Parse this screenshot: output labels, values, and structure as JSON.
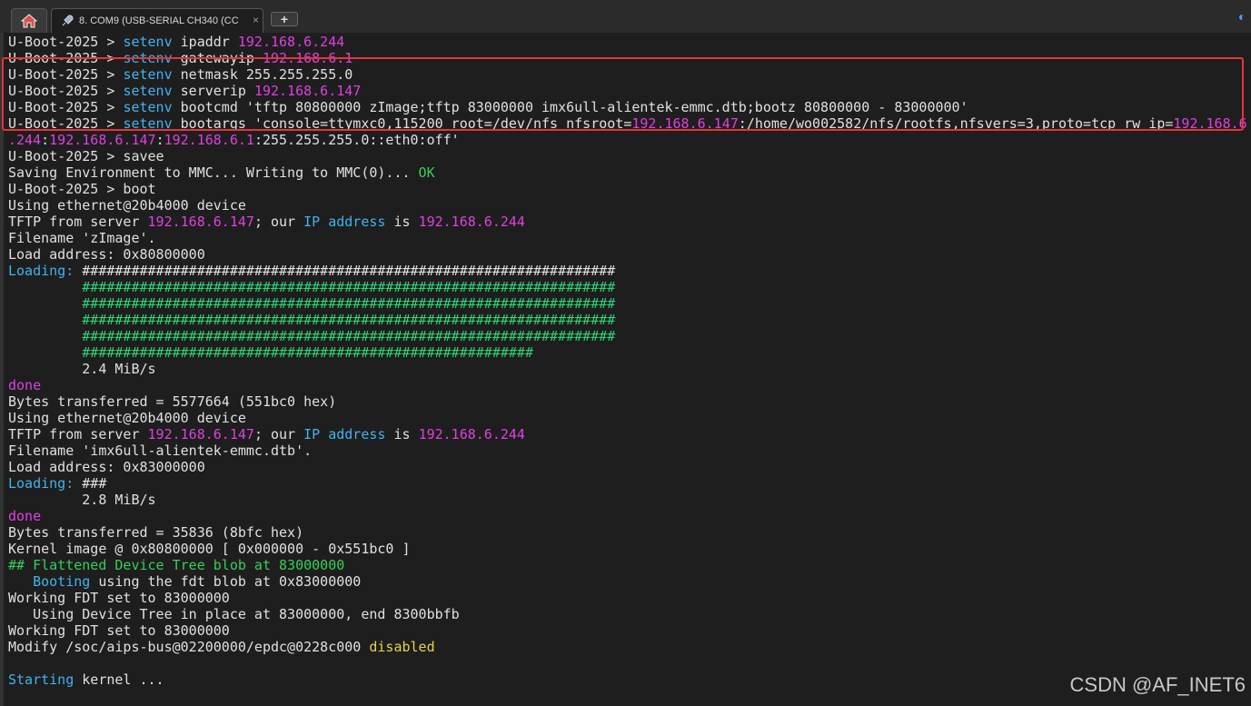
{
  "tabs": {
    "home_icon": "home-icon",
    "active_tab_label": "8. COM9  (USB-SERIAL CH340 (CC",
    "active_tab_icon": "rocket-icon",
    "close_glyph": "×",
    "new_tab_glyph": "+",
    "menu_glyph": "◐"
  },
  "terminal": {
    "lines": [
      [
        [
          "U-Boot-2025 > ",
          "d"
        ],
        [
          "setenv",
          "c"
        ],
        [
          " ipaddr ",
          "d"
        ],
        [
          "192.168.6.244",
          "m"
        ]
      ],
      [
        [
          "U-Boot-2025 > ",
          "d"
        ],
        [
          "setenv",
          "c"
        ],
        [
          " gatewayip ",
          "d"
        ],
        [
          "192.168.6.1",
          "m"
        ]
      ],
      [
        [
          "U-Boot-2025 > ",
          "d"
        ],
        [
          "setenv",
          "c"
        ],
        [
          " netmask 255.255.255.0",
          "d"
        ]
      ],
      [
        [
          "U-Boot-2025 > ",
          "d"
        ],
        [
          "setenv",
          "c"
        ],
        [
          " serverip ",
          "d"
        ],
        [
          "192.168.6.147",
          "m"
        ]
      ],
      [
        [
          "U-Boot-2025 > ",
          "d"
        ],
        [
          "setenv",
          "c"
        ],
        [
          " bootcmd 'tftp 80800000 zImage;tftp 83000000 imx6ull-alientek-emmc.dtb;bootz 80800000 - 83000000'",
          "d"
        ]
      ],
      [
        [
          "U-Boot-2025 > ",
          "d"
        ],
        [
          "setenv",
          "c"
        ],
        [
          " bootargs 'console=ttymxc0,115200 root=/dev/nfs nfsroot=",
          "d"
        ],
        [
          "192.168.6.147",
          "m"
        ],
        [
          ":/home/wo002582/nfs/rootfs,nfsvers=3,proto=tcp rw ip=",
          "d"
        ],
        [
          "192.168.6",
          "m"
        ]
      ],
      [
        [
          ".244",
          "m"
        ],
        [
          ":",
          "d"
        ],
        [
          "192.168.6.147",
          "m"
        ],
        [
          ":",
          "d"
        ],
        [
          "192.168.6.1",
          "m"
        ],
        [
          ":255.255.255.0::eth0:off'",
          "d"
        ]
      ],
      [
        [
          "U-Boot-2025 > savee",
          "d"
        ]
      ],
      [
        [
          "Saving Environment to MMC... Writing to MMC(0)... ",
          "d"
        ],
        [
          "OK",
          "l"
        ]
      ],
      [
        [
          "U-Boot-2025 > boot",
          "d"
        ]
      ],
      [
        [
          "Using ethernet@20b4000 device",
          "d"
        ]
      ],
      [
        [
          "TFTP from server ",
          "d"
        ],
        [
          "192.168.6.147",
          "m"
        ],
        [
          "; our ",
          "d"
        ],
        [
          "IP address",
          "c"
        ],
        [
          " is ",
          "d"
        ],
        [
          "192.168.6.244",
          "m"
        ]
      ],
      [
        [
          "Filename 'zImage'.",
          "d"
        ]
      ],
      [
        [
          "Load address: 0x80800000",
          "d"
        ]
      ],
      [
        [
          "Loading: ",
          "c"
        ],
        [
          "#################################################################",
          "d"
        ]
      ],
      [
        [
          "         ",
          "d"
        ],
        [
          "#################################################################",
          "g"
        ]
      ],
      [
        [
          "         ",
          "d"
        ],
        [
          "#################################################################",
          "g"
        ]
      ],
      [
        [
          "         ",
          "d"
        ],
        [
          "#################################################################",
          "g"
        ]
      ],
      [
        [
          "         ",
          "d"
        ],
        [
          "#################################################################",
          "g"
        ]
      ],
      [
        [
          "         ",
          "d"
        ],
        [
          "#######################################################",
          "g"
        ]
      ],
      [
        [
          "         2.4 MiB/s",
          "d"
        ]
      ],
      [
        [
          "done",
          "m"
        ]
      ],
      [
        [
          "Bytes transferred = 5577664 (551bc0 hex)",
          "d"
        ]
      ],
      [
        [
          "Using ethernet@20b4000 device",
          "d"
        ]
      ],
      [
        [
          "TFTP from server ",
          "d"
        ],
        [
          "192.168.6.147",
          "m"
        ],
        [
          "; our ",
          "d"
        ],
        [
          "IP address",
          "c"
        ],
        [
          " is ",
          "d"
        ],
        [
          "192.168.6.244",
          "m"
        ]
      ],
      [
        [
          "Filename 'imx6ull-alientek-emmc.dtb'.",
          "d"
        ]
      ],
      [
        [
          "Load address: 0x83000000",
          "d"
        ]
      ],
      [
        [
          "Loading: ",
          "c"
        ],
        [
          "###",
          "d"
        ]
      ],
      [
        [
          "         2.8 MiB/s",
          "d"
        ]
      ],
      [
        [
          "done",
          "m"
        ]
      ],
      [
        [
          "Bytes transferred = 35836 (8bfc hex)",
          "d"
        ]
      ],
      [
        [
          "Kernel image @ 0x80800000 [ 0x000000 - 0x551bc0 ]",
          "d"
        ]
      ],
      [
        [
          "## Flattened Device Tree blob at 83000000",
          "l"
        ]
      ],
      [
        [
          "   ",
          "d"
        ],
        [
          "Booting",
          "c"
        ],
        [
          " using the fdt blob at 0x83000000",
          "d"
        ]
      ],
      [
        [
          "Working FDT set to 83000000",
          "d"
        ]
      ],
      [
        [
          "   Using Device Tree in place at 83000000, end 8300bbfb",
          "d"
        ]
      ],
      [
        [
          "Working FDT set to 83000000",
          "d"
        ]
      ],
      [
        [
          "Modify /soc/aips-bus@02200000/epdc@0228c000 ",
          "d"
        ],
        [
          "disabled",
          "y"
        ]
      ],
      [
        [
          "",
          "d"
        ]
      ],
      [
        [
          "Starting",
          "c"
        ],
        [
          " kernel ...",
          "d"
        ]
      ]
    ]
  },
  "colors": {
    "background": "#1e1e1e",
    "default": "#e0e0e0",
    "cyan": "#3fb4ef",
    "magenta": "#e040e0",
    "green": "#2ed47a",
    "highlight_border": "#e8333a"
  },
  "watermark": "CSDN @AF_INET6"
}
